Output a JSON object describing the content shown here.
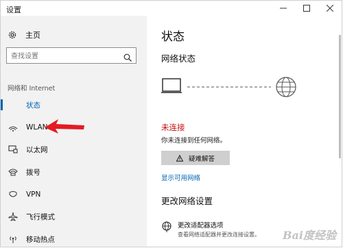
{
  "window": {
    "title": "设置"
  },
  "nav": {
    "home_label": "主页",
    "search_placeholder": "查找设置",
    "section_label": "网络和 Internet",
    "items": [
      {
        "label": "状态",
        "icon": "status-icon",
        "active": true
      },
      {
        "label": "WLAN",
        "icon": "wifi-icon",
        "active": false
      },
      {
        "label": "以太网",
        "icon": "ethernet-icon",
        "active": false
      },
      {
        "label": "拨号",
        "icon": "dialup-icon",
        "active": false
      },
      {
        "label": "VPN",
        "icon": "vpn-icon",
        "active": false
      },
      {
        "label": "飞行模式",
        "icon": "airplane-icon",
        "active": false
      },
      {
        "label": "移动热点",
        "icon": "hotspot-icon",
        "active": false
      }
    ]
  },
  "main": {
    "title": "状态",
    "network_status_heading": "网络状态",
    "status_text": "未连接",
    "status_subtext": "你未连接到任何网络。",
    "troubleshoot_label": "疑难解答",
    "show_networks_link": "显示可用网络",
    "change_settings_heading": "更改网络设置",
    "adapter_title": "更改适配器选项",
    "adapter_desc": "查看网络适配器并更改连接设置。"
  },
  "watermark": "Bai度经验",
  "colors": {
    "accent": "#0063b1",
    "error": "#c50f0f",
    "annotation_arrow": "#e31b23"
  }
}
